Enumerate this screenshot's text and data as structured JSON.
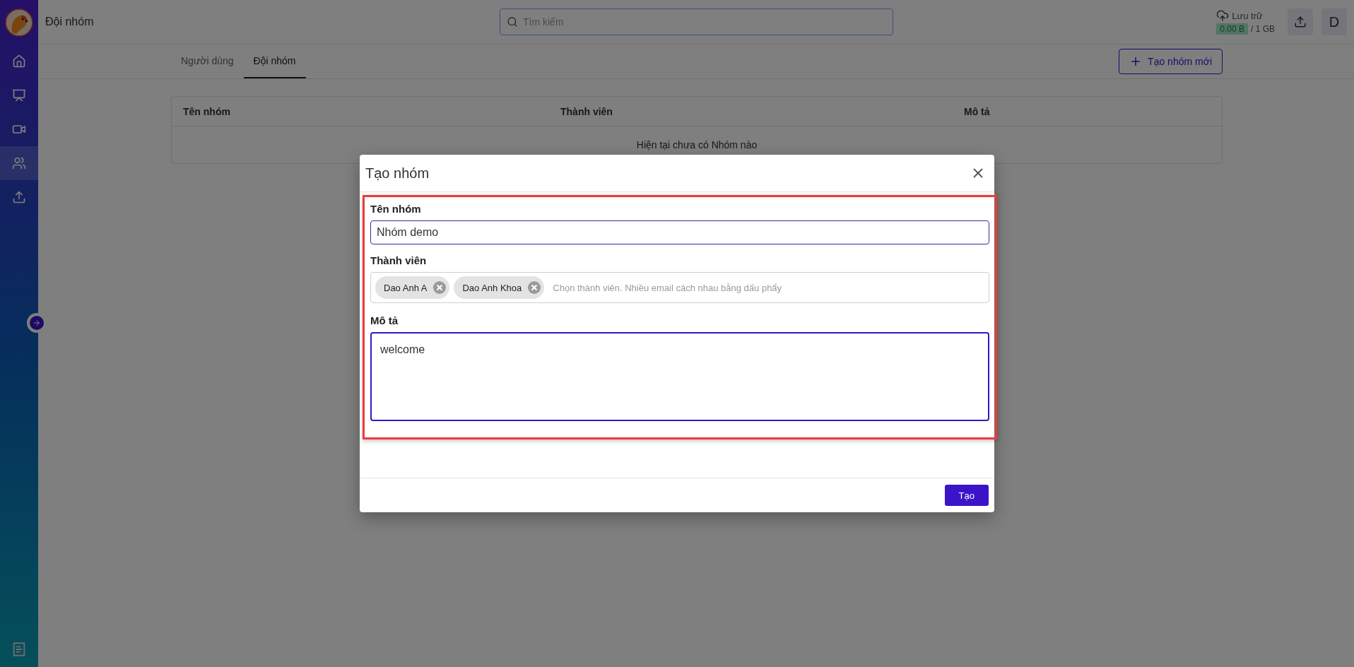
{
  "app": {
    "page_title": "Đội nhóm",
    "search": {
      "placeholder": "Tìm kiếm"
    },
    "storage": {
      "label": "Lưu trữ",
      "used": "0.00 B",
      "total": "/ 1 GB"
    },
    "avatar": "D"
  },
  "sidebar": {
    "items": [
      {
        "kind": "home",
        "selected": false
      },
      {
        "kind": "meeting",
        "selected": false
      },
      {
        "kind": "video",
        "selected": false
      },
      {
        "kind": "team",
        "selected": true
      },
      {
        "kind": "upload",
        "selected": false
      }
    ],
    "bottom_item": {
      "kind": "billing"
    }
  },
  "tabs": [
    {
      "label": "Người dùng",
      "selected": false
    },
    {
      "label": "Đội nhóm",
      "selected": true
    }
  ],
  "create_button": {
    "label": "Tạo nhóm mới"
  },
  "table": {
    "columns": [
      "Tên nhóm",
      "Thành viên",
      "Mô tả"
    ],
    "empty_message": "Hiện tại chưa có Nhóm nào"
  },
  "dialog": {
    "title": "Tạo nhóm",
    "highlighted": true,
    "fields": [
      {
        "kind": "text",
        "label": "Tên nhóm",
        "value": "Nhóm demo"
      },
      {
        "kind": "chips",
        "label": "Thành viên",
        "chips": [
          "Dao Anh A",
          "Dao Anh Khoa"
        ],
        "placeholder": "Chọn thành viên. Nhiều email cách nhau bằng dấu phẩy"
      },
      {
        "kind": "textarea",
        "label": "Mô tả",
        "value": "welcome"
      }
    ],
    "submit": "Tạo"
  }
}
